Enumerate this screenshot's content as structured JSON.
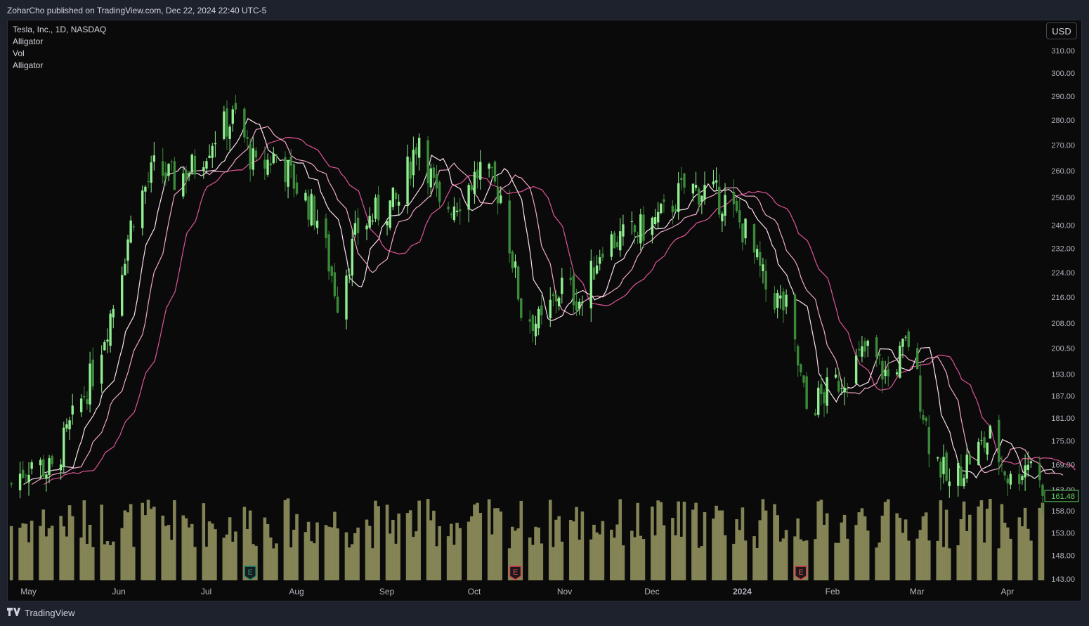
{
  "header": {
    "published_text": "ZoharCho published on TradingView.com, Dec 22, 2024 22:40 UTC-5"
  },
  "legend": {
    "symbol": "Tesla, Inc., 1D, NASDAQ",
    "indicators": [
      "Alligator",
      "Vol",
      "Alligator"
    ]
  },
  "currency_button": "USD",
  "footer": {
    "brand": "TradingView",
    "logo_icon": "tradingview-logo-icon"
  },
  "colors": {
    "background": "#0a0a0a",
    "up_candle": "#90ee90",
    "down_candle": "#3a8a3a",
    "volume": "#8a8a5a",
    "alligator_jaw": "#e0559a",
    "alligator_teeth": "#f0a8c8",
    "alligator_lips": "#fbe0ec",
    "last_price": "#5fd35f",
    "earnings_green": "#1e8a7a",
    "earnings_red": "#e04050"
  },
  "chart_data": {
    "type": "candlestick",
    "title": "Tesla, Inc., 1D, NASDAQ",
    "y_scale": "log",
    "ylim": [
      143,
      315
    ],
    "y_ticks": [
      "310.00",
      "300.00",
      "290.00",
      "280.00",
      "270.00",
      "260.00",
      "250.00",
      "240.00",
      "232.00",
      "224.00",
      "216.00",
      "208.00",
      "200.50",
      "193.00",
      "187.00",
      "181.00",
      "175.00",
      "169.00",
      "163.00",
      "158.00",
      "153.00",
      "148.00",
      "143.00"
    ],
    "x_ticks": [
      "May",
      "Jun",
      "Jul",
      "Aug",
      "Sep",
      "Oct",
      "Nov",
      "Dec",
      "2024",
      "Feb",
      "Mar",
      "Apr"
    ],
    "last_price": "161.48",
    "earnings_markers": [
      {
        "label": "E",
        "date": "Jul 19",
        "kind": "positive"
      },
      {
        "label": "E",
        "date": "Oct 18",
        "kind": "negative"
      },
      {
        "label": "E",
        "date": "Jan 24",
        "kind": "negative"
      }
    ],
    "close_path": [
      {
        "date": "2023-04-28",
        "close": 164.3
      },
      {
        "date": "2023-05-05",
        "close": 170.1
      },
      {
        "date": "2023-05-12",
        "close": 167.0
      },
      {
        "date": "2023-05-19",
        "close": 180.1
      },
      {
        "date": "2023-05-26",
        "close": 193.2
      },
      {
        "date": "2023-06-02",
        "close": 213.9
      },
      {
        "date": "2023-06-09",
        "close": 244.4
      },
      {
        "date": "2023-06-16",
        "close": 260.5
      },
      {
        "date": "2023-06-23",
        "close": 256.6
      },
      {
        "date": "2023-06-30",
        "close": 261.8
      },
      {
        "date": "2023-07-07",
        "close": 274.4
      },
      {
        "date": "2023-07-14",
        "close": 281.4
      },
      {
        "date": "2023-07-21",
        "close": 260.0
      },
      {
        "date": "2023-07-28",
        "close": 266.4
      },
      {
        "date": "2023-08-04",
        "close": 253.9
      },
      {
        "date": "2023-08-11",
        "close": 242.7
      },
      {
        "date": "2023-08-18",
        "close": 215.5
      },
      {
        "date": "2023-08-25",
        "close": 238.6
      },
      {
        "date": "2023-09-01",
        "close": 245.0
      },
      {
        "date": "2023-09-08",
        "close": 248.5
      },
      {
        "date": "2023-09-15",
        "close": 274.4
      },
      {
        "date": "2023-09-22",
        "close": 244.9
      },
      {
        "date": "2023-09-29",
        "close": 250.2
      },
      {
        "date": "2023-10-06",
        "close": 260.5
      },
      {
        "date": "2023-10-13",
        "close": 251.1
      },
      {
        "date": "2023-10-20",
        "close": 211.99
      },
      {
        "date": "2023-10-27",
        "close": 207.3
      },
      {
        "date": "2023-11-03",
        "close": 219.96
      },
      {
        "date": "2023-11-10",
        "close": 214.65
      },
      {
        "date": "2023-11-17",
        "close": 234.3
      },
      {
        "date": "2023-11-24",
        "close": 235.45
      },
      {
        "date": "2023-12-01",
        "close": 238.83
      },
      {
        "date": "2023-12-08",
        "close": 243.84
      },
      {
        "date": "2023-12-15",
        "close": 253.5
      },
      {
        "date": "2023-12-22",
        "close": 252.54
      },
      {
        "date": "2023-12-29",
        "close": 248.48
      },
      {
        "date": "2024-01-05",
        "close": 237.49
      },
      {
        "date": "2024-01-12",
        "close": 218.89
      },
      {
        "date": "2024-01-19",
        "close": 212.19
      },
      {
        "date": "2024-01-26",
        "close": 183.25
      },
      {
        "date": "2024-02-02",
        "close": 187.91
      },
      {
        "date": "2024-02-09",
        "close": 193.57
      },
      {
        "date": "2024-02-16",
        "close": 199.95
      },
      {
        "date": "2024-02-23",
        "close": 191.97
      },
      {
        "date": "2024-03-01",
        "close": 202.64
      },
      {
        "date": "2024-03-08",
        "close": 175.34
      },
      {
        "date": "2024-03-15",
        "close": 163.57
      },
      {
        "date": "2024-03-22",
        "close": 170.83
      },
      {
        "date": "2024-03-29",
        "close": 175.79
      },
      {
        "date": "2024-04-05",
        "close": 164.9
      },
      {
        "date": "2024-04-12",
        "close": 171.05
      },
      {
        "date": "2024-04-16",
        "close": 161.48
      }
    ]
  }
}
